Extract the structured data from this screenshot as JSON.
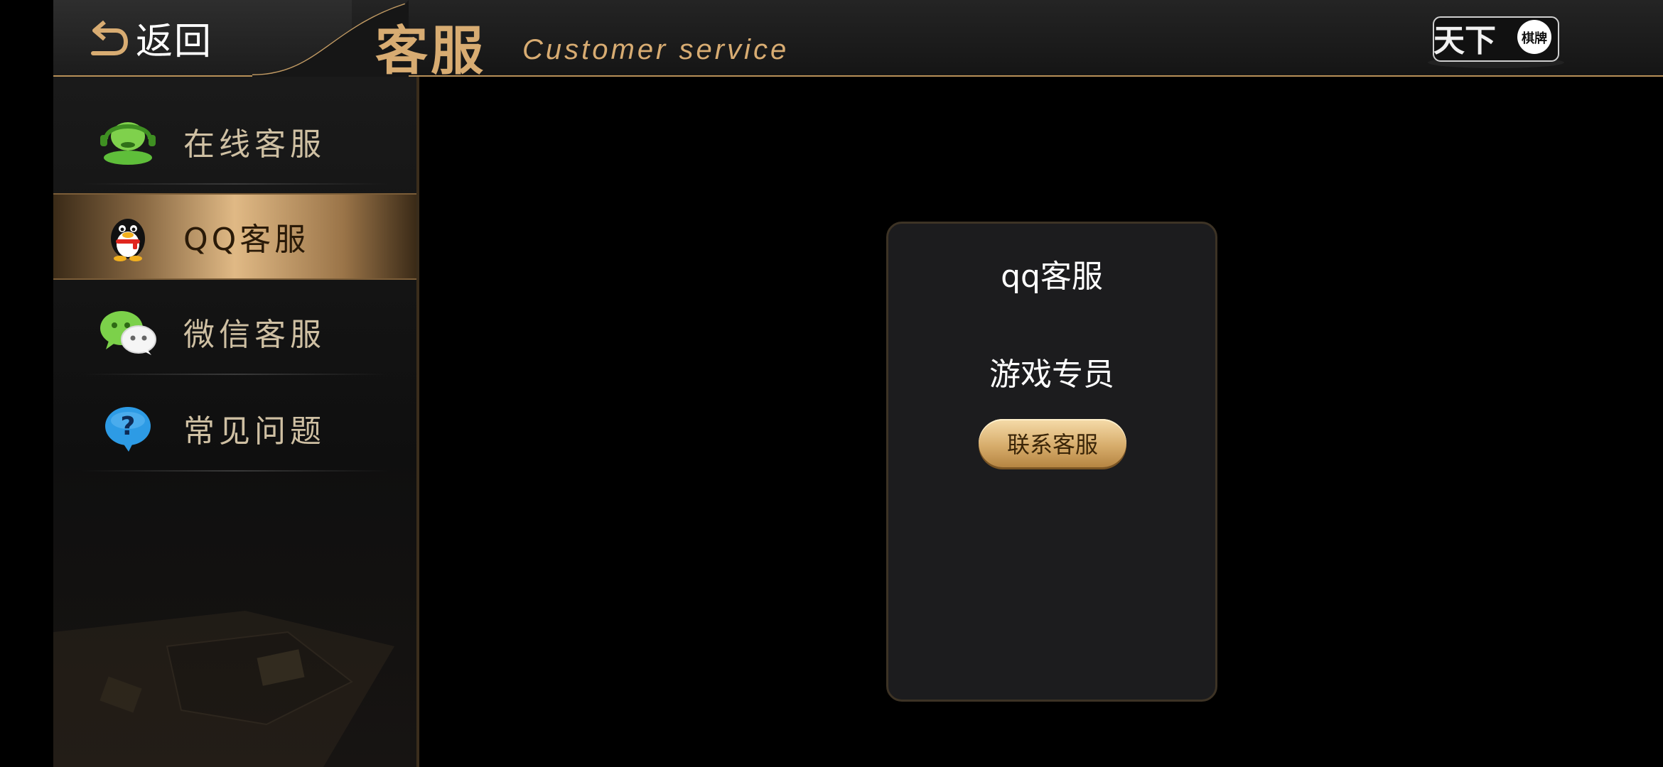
{
  "header": {
    "back_label": "返回",
    "title": "客服",
    "subtitle": "Customer service",
    "logo_text": "天下",
    "logo_subtext": "棋牌"
  },
  "sidebar": {
    "items": [
      {
        "label": "在线客服",
        "icon": "headset-icon",
        "active": false
      },
      {
        "label": "QQ客服",
        "icon": "qq-penguin-icon",
        "active": true
      },
      {
        "label": "微信客服",
        "icon": "wechat-icon",
        "active": false
      },
      {
        "label": "常见问题",
        "icon": "question-icon",
        "active": false
      }
    ]
  },
  "card": {
    "title": "qq客服",
    "subtitle": "游戏专员",
    "button_label": "联系客服"
  },
  "colors": {
    "accent_gold": "#d8ac72",
    "background": "#000000",
    "card_bg": "#1c1c1e"
  }
}
